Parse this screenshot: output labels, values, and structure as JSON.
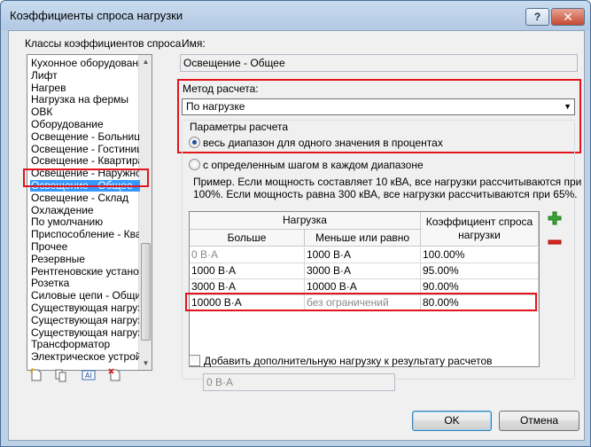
{
  "window": {
    "title": "Коэффициенты спроса нагрузки",
    "help_label": "?",
    "close_label": "✕"
  },
  "left": {
    "list_label": "Классы коэффициентов спроса",
    "items": [
      "Кухонное оборудование -",
      "Лифт",
      "Нагрев",
      "Нагрузка на фермы",
      "ОВК",
      "Оборудование",
      "Освещение - Больница",
      "Освещение - Гостиница",
      "Освещение - Квартира",
      "Освещение - Наружное",
      "Освещение - Общее",
      "Освещение - Склад",
      "Охлаждение",
      "По умолчанию",
      "Приспособление - Кварти",
      "Прочее",
      "Резервные",
      "Рентгеновские установки",
      "Розетка",
      "Силовые цепи - Общие",
      "Существующая нагрузка",
      "Существующая нагрузка",
      "Существующая нагрузка",
      "Трансформатор",
      "Электрическое устройств"
    ],
    "selected_index": 10,
    "scroll_up": "▲",
    "scroll_down": "▼"
  },
  "form": {
    "name_label": "Имя:",
    "name_value": "Освещение - Общее",
    "method_label": "Метод расчета:",
    "method_value": "По нагрузке",
    "params_label": "Параметры расчета",
    "radio1_label": "весь диапазон для одного значения в процентах",
    "radio2_label": "с определенным шагом в каждом диапазоне",
    "example_line1": "Пример. Если мощность составляет 10 кВА, все нагрузки рассчитываются при",
    "example_line2": "100%. Если мощность равна 300 кВА, все нагрузки рассчитываются при 65%.",
    "table": {
      "group_header": "Нагрузка",
      "col_more": "Больше",
      "col_less": "Меньше или равно",
      "col_factor_1": "Коэффициент спроса",
      "col_factor_2": "нагрузки",
      "rows": [
        {
          "more": "0 В·А",
          "less": "1000 В·А",
          "factor": "100.00%"
        },
        {
          "more": "1000 В·А",
          "less": "3000 В·А",
          "factor": "95.00%"
        },
        {
          "more": "3000 В·А",
          "less": "10000 В·А",
          "factor": "90.00%"
        },
        {
          "more": "10000 В·А",
          "less": "без ограничений",
          "factor": "80.00%"
        }
      ]
    },
    "add_icon": "+",
    "remove_icon": "−",
    "extra_load_label": "Добавить дополнительную нагрузку к результату расчетов",
    "extra_load_value": "0 В·А"
  },
  "buttons": {
    "ok": "OK",
    "cancel": "Отмена"
  },
  "colors": {
    "highlight": "#e3141c",
    "selection": "#3399ff"
  }
}
